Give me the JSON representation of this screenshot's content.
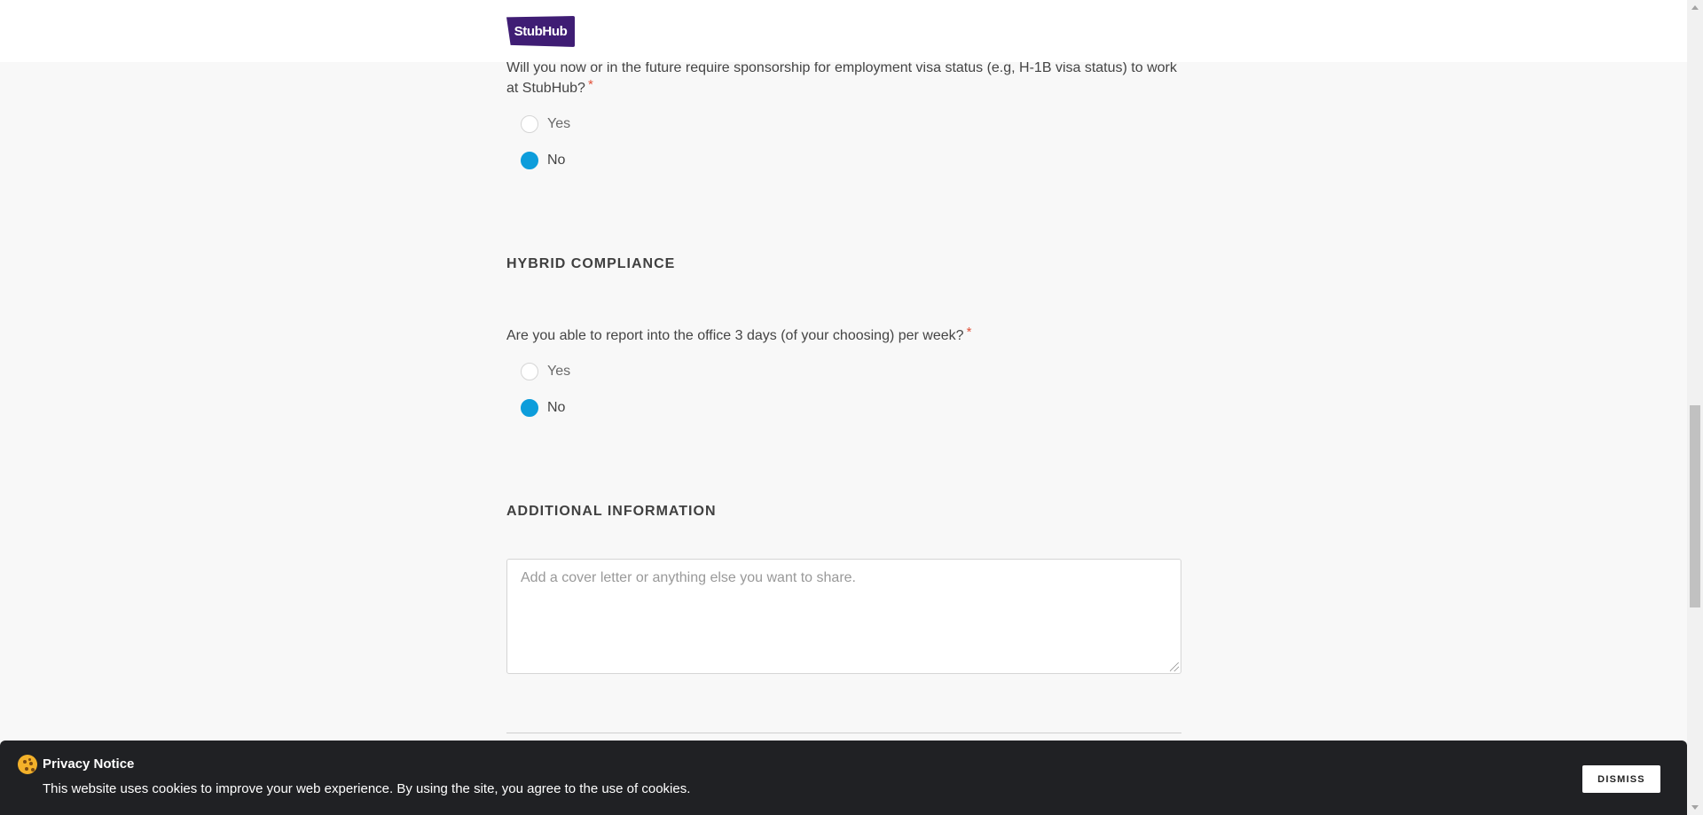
{
  "header": {
    "logo_text": "StubHub",
    "brand_color": "#3f1d74"
  },
  "visa_question": {
    "text": "Will you now or in the future require sponsorship for employment visa status (e.g, H-1B visa status) to work at StubHub?",
    "required_marker": "*",
    "options": [
      {
        "label": "Yes",
        "checked": false
      },
      {
        "label": "No",
        "checked": true
      }
    ]
  },
  "hybrid_section": {
    "title": "HYBRID COMPLIANCE",
    "question": {
      "text": "Are you able to report into the office 3 days (of your choosing) per week?",
      "required_marker": "*",
      "options": [
        {
          "label": "Yes",
          "checked": false
        },
        {
          "label": "No",
          "checked": true
        }
      ]
    }
  },
  "additional_section": {
    "title": "ADDITIONAL INFORMATION",
    "textarea_value": "",
    "textarea_placeholder": "Add a cover letter or anything else you want to share."
  },
  "cookie_banner": {
    "title": "Privacy Notice",
    "text": "This website uses cookies to improve your web experience. By using the site, you agree to the use of cookies.",
    "dismiss_label": "DISMISS"
  },
  "colors": {
    "radio_checked": "#0d9ddb",
    "required_asterisk": "#e2533b",
    "banner_bg": "#202124"
  }
}
